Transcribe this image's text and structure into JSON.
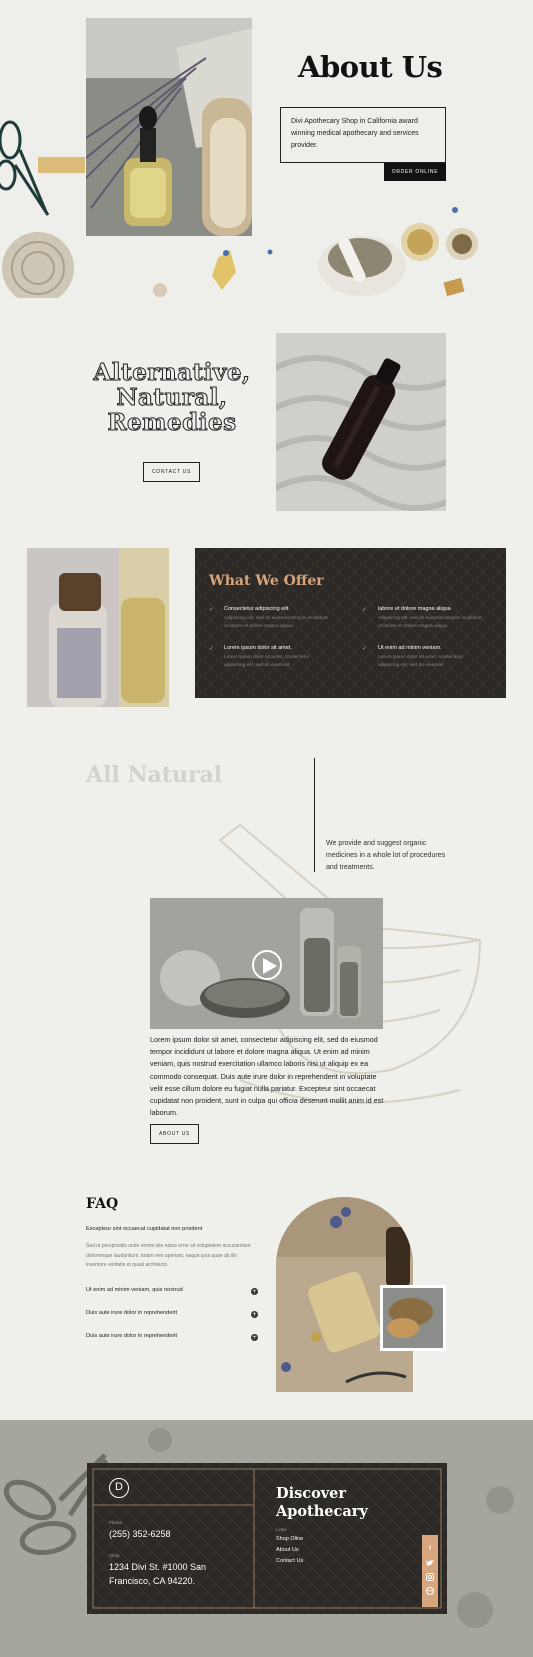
{
  "hero": {
    "title": "About Us",
    "description": "Divi Apothecary Shop in California award winning medical apothecary and services provider.",
    "button_label": "ORDER ONLINE"
  },
  "alternative": {
    "title_line1": "Alternative,",
    "title_line2": "Natural,",
    "title_line3": "Remedies",
    "button_label": "CONTACT US"
  },
  "offer": {
    "title": "What We Offer",
    "items": [
      {
        "title": "Consectetur adipiscing elit.",
        "text_line1": "Adipiscing elit, sed do eiusmod tempor incididunt",
        "text_line2": "ut labore et dolore magna aliqua."
      },
      {
        "title": "labore et dolore magna aliqua",
        "text_line1": "Adipiscing elit, sed do eiusmod tempor incididunt",
        "text_line2": "ut labore et dolore magna aliqua."
      },
      {
        "title": "Lorem ipsum dolor sit amet.",
        "text_line1": "Lorem ipsum dolor sit amet, consectetur",
        "text_line2": "adipiscing elit, sed do eiusmod."
      },
      {
        "title": "Ut enim ad minim veniam.",
        "text_line1": "Lorem ipsum dolor sit amet, consectetur",
        "text_line2": "adipiscing elit, sed do eiusmod."
      }
    ]
  },
  "natural": {
    "title": "All Natural",
    "text": "We provide and suggest organic medicines in a whole lot of procedures and treatments.",
    "body": "Lorem ipsum dolor sit amet, consectetur adipiscing elit, sed do eiusmod tempor incididunt ut labore et dolore magna aliqua. Ut enim ad minim veniam, quis nostrud exercitation ullamco laboris nisi ut aliquip ex ea commodo consequat. Duis aute irure dolor in reprehenderit in voluptate velit esse cillum dolore eu fugiat nulla pariatur. Excepteur sint occaecat cupidatat non proident, sunt in culpa qui officia deserunt mollit anim id est laborum.",
    "button_label": "ABOUT US"
  },
  "faq": {
    "title": "FAQ",
    "open_question": "Excepteur sint occaecat cupidatat non proident",
    "open_answer": "Sed ut perspiciatis unde omnis iste natus error sit voluptatem accusantium doloremque laudantium, totam rem aperiam, eaque ipsa quae ab illo inventore veritatis et quasi architecto.",
    "questions": [
      "Ut enim ad minim veniam, quis nostrud",
      "Duis aute irure dolor in reprehenderit",
      "Duis aute irure dolor in reprehenderit"
    ]
  },
  "footer": {
    "logo_letter": "D",
    "phone_label": "Phone",
    "phone": "(255) 352-6258",
    "shop_label": "Shop",
    "address_line1": "1234 Divi St. #1000 San",
    "address_line2": "Francisco, CA 94220.",
    "heading_line1": "Discover",
    "heading_line2": "Apothecary",
    "links_label": "Links",
    "links": [
      "Shop Oline",
      "About Us",
      "Contact Us"
    ],
    "social_icons": [
      "facebook-icon",
      "twitter-icon",
      "instagram-icon",
      "dribbble-icon"
    ]
  },
  "colors": {
    "background": "#efefeb",
    "dark_panel": "#2c2926",
    "accent": "#d8a67e",
    "text": "#222222"
  }
}
